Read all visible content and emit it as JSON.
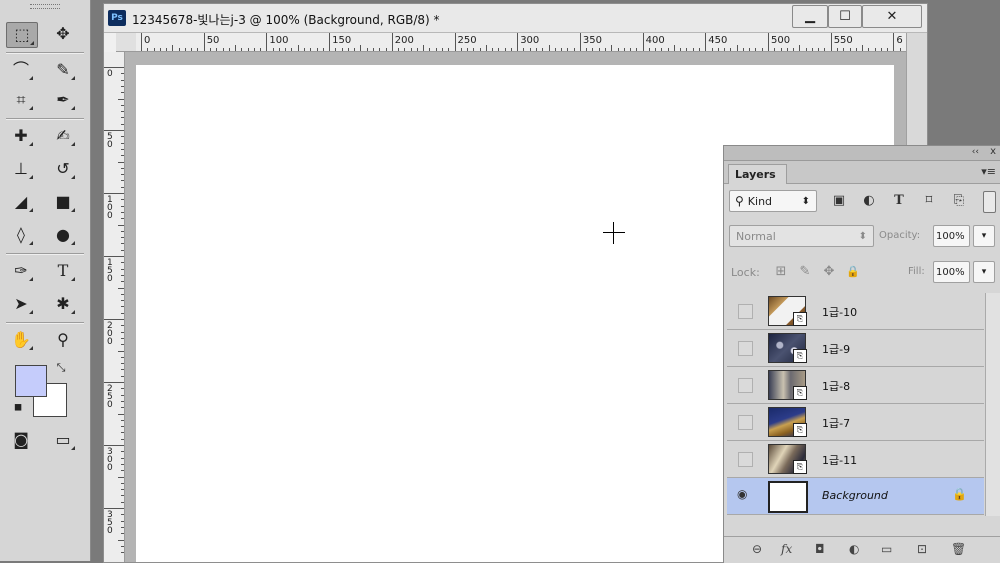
{
  "document": {
    "badge": "Ps",
    "title": "12345678-빛나는j-3 @ 100% (Background, RGB/8) *",
    "minimize": "▁",
    "maximize": "☐",
    "close": "✕",
    "ruler_h": [
      "0",
      "50",
      "100",
      "150",
      "200",
      "250",
      "300",
      "350",
      "400",
      "450",
      "500",
      "550",
      "6"
    ],
    "ruler_v": [
      "0",
      "50",
      "100",
      "150",
      "200",
      "250",
      "300",
      "350"
    ]
  },
  "tools": {
    "rect_marquee": "⬚",
    "move": "✥",
    "lasso": "⌒",
    "quick_select": "✎",
    "crop": "⌗",
    "eyedropper": "✒",
    "healing": "✚",
    "brush": "✍",
    "stamp": "⊥",
    "history_brush": "↺",
    "eraser": "◢",
    "gradient": "■",
    "blur": "◊",
    "dodge": "●",
    "pen": "✑",
    "type": "T",
    "path_select": "➤",
    "shape": "✱",
    "hand": "✋",
    "zoom": "⚲",
    "swap": "⤡",
    "default_colors": "◼",
    "quick_mask": "◙",
    "screen_mode": "▭",
    "fg_color": "#c5ccfb",
    "bg_color": "#ffffff"
  },
  "layers_panel": {
    "collapse": "‹‹",
    "close": "x",
    "tab": "Layers",
    "menu": "▾≡",
    "filter_icon": "⚲",
    "filter_kind": "Kind",
    "filter_arrows": "⬍",
    "filter_icons": [
      "▣",
      "◐",
      "T",
      "⌑",
      "⎘"
    ],
    "blend_mode": "Normal",
    "blend_arrows": "⬍",
    "opacity_label": "Opacity:",
    "opacity_value": "100%",
    "dropdown": "▾",
    "lock_label": "Lock:",
    "lock_icons": [
      "⊞",
      "✎",
      "✥",
      "🔒"
    ],
    "fill_label": "Fill:",
    "fill_value": "100%",
    "layers": [
      {
        "name": "1급-10"
      },
      {
        "name": "1급-9"
      },
      {
        "name": "1급-8"
      },
      {
        "name": "1급-7"
      },
      {
        "name": "1급-11"
      },
      {
        "name": "Background",
        "lock": "🔒"
      }
    ],
    "eye": "◉",
    "smart_badge": "⎘",
    "bottom_icons": [
      "⊖",
      "fx",
      "◘",
      "◐",
      "▭",
      "⊡",
      "🗑"
    ]
  }
}
